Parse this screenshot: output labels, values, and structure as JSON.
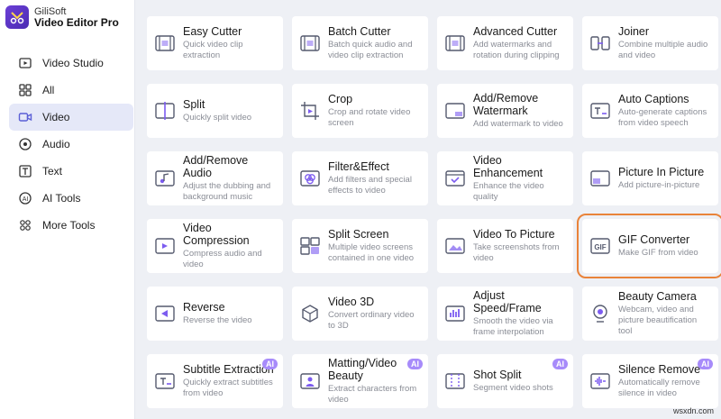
{
  "brand": {
    "company": "GiliSoft",
    "product": "Video Editor Pro"
  },
  "colors": {
    "accent": "#6b3fd6",
    "active_bg": "#e5e8f8",
    "highlight": "#e9833a",
    "ai_badge": "#a78bfa"
  },
  "sidebar": {
    "items": [
      {
        "label": "Video Studio",
        "icon": "video-studio-icon",
        "active": false
      },
      {
        "label": "All",
        "icon": "grid-icon",
        "active": false
      },
      {
        "label": "Video",
        "icon": "video-icon",
        "active": true
      },
      {
        "label": "Audio",
        "icon": "audio-icon",
        "active": false
      },
      {
        "label": "Text",
        "icon": "text-icon",
        "active": false
      },
      {
        "label": "AI Tools",
        "icon": "ai-icon",
        "active": false
      },
      {
        "label": "More Tools",
        "icon": "more-tools-icon",
        "active": false
      }
    ]
  },
  "tools": [
    {
      "title": "Easy Cutter",
      "desc": "Quick video clip extraction",
      "icon": "film-icon"
    },
    {
      "title": "Batch Cutter",
      "desc": "Batch quick audio and video clip extraction",
      "icon": "film-icon"
    },
    {
      "title": "Advanced Cutter",
      "desc": "Add watermarks and rotation during clipping",
      "icon": "film-icon"
    },
    {
      "title": "Joiner",
      "desc": "Combine multiple audio and video",
      "icon": "joiner-icon"
    },
    {
      "title": "Split",
      "desc": "Quickly split video",
      "icon": "split-icon"
    },
    {
      "title": "Crop",
      "desc": "Crop and rotate video screen",
      "icon": "crop-icon"
    },
    {
      "title": "Add/Remove Watermark",
      "desc": "Add watermark to video",
      "icon": "watermark-icon"
    },
    {
      "title": "Auto Captions",
      "desc": "Auto-generate captions from video speech",
      "icon": "captions-icon"
    },
    {
      "title": "Add/Remove Audio",
      "desc": "Adjust the dubbing and background music",
      "icon": "audio-music-icon"
    },
    {
      "title": "Filter&Effect",
      "desc": "Add filters and special effects to video",
      "icon": "filter-icon"
    },
    {
      "title": "Video Enhancement",
      "desc": "Enhance the video quality",
      "icon": "enhance-icon"
    },
    {
      "title": "Picture In Picture",
      "desc": "Add picture-in-picture",
      "icon": "pip-icon"
    },
    {
      "title": "Video Compression",
      "desc": "Compress audio and video",
      "icon": "compress-icon"
    },
    {
      "title": "Split Screen",
      "desc": "Multiple video screens contained in one video",
      "icon": "split-screen-icon"
    },
    {
      "title": "Video To Picture",
      "desc": "Take screenshots from video",
      "icon": "picture-icon"
    },
    {
      "title": "GIF Converter",
      "desc": "Make GIF from video",
      "icon": "gif-icon",
      "highlight": true
    },
    {
      "title": "Reverse",
      "desc": "Reverse the video",
      "icon": "reverse-icon"
    },
    {
      "title": "Video 3D",
      "desc": "Convert ordinary video to 3D",
      "icon": "cube-icon"
    },
    {
      "title": "Adjust Speed/Frame",
      "desc": "Smooth the video via frame interpolation",
      "icon": "speed-icon"
    },
    {
      "title": "Beauty Camera",
      "desc": "Webcam, video and picture beautification tool",
      "icon": "camera-icon"
    },
    {
      "title": "Subtitle Extraction",
      "desc": "Quickly extract subtitles from video",
      "icon": "subtitle-icon",
      "ai": true
    },
    {
      "title": "Matting/Video Beauty",
      "desc": "Extract characters from video",
      "icon": "matting-icon",
      "ai": true
    },
    {
      "title": "Shot Split",
      "desc": "Segment video shots",
      "icon": "shot-split-icon",
      "ai": true
    },
    {
      "title": "Silence Remove",
      "desc": "Automatically remove silence in video",
      "icon": "silence-icon",
      "ai": true
    }
  ],
  "ai_badge_label": "AI",
  "watermark": "wsxdn.com"
}
